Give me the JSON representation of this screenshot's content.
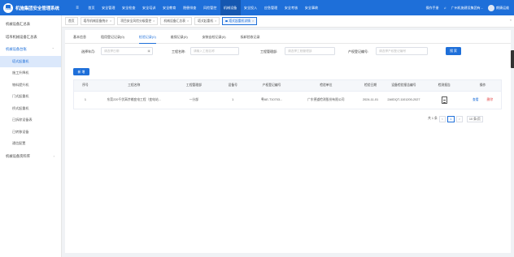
{
  "app": {
    "title": "机施集团安全管理系统",
    "logo_text": "中国建筑"
  },
  "topnav": {
    "toggle": "≡",
    "items": [
      "首页",
      "安全管理",
      "安全检查",
      "安全培训",
      "安全教育",
      "隐患排查",
      "风险管控",
      "机械设备",
      "安全投入",
      "应急管理",
      "安全考核",
      "安全事故"
    ],
    "active_index": 7,
    "manual": "操作手册",
    "company": "广州机施建设集团有...",
    "username": "朗康运维"
  },
  "sidebar": {
    "items": [
      {
        "label": "机械设备汇总表",
        "type": "item"
      },
      {
        "label": "塔吊机械设备汇总表",
        "type": "item"
      },
      {
        "label": "机械设备台账",
        "type": "parent"
      },
      {
        "label": "塔式起重机",
        "type": "sub",
        "active": true
      },
      {
        "label": "施工升降机",
        "type": "sub"
      },
      {
        "label": "物料提升机",
        "type": "sub"
      },
      {
        "label": "门式起重机",
        "type": "sub"
      },
      {
        "label": "桥式起重机",
        "type": "sub"
      },
      {
        "label": "已拆除设备表",
        "type": "sub"
      },
      {
        "label": "已转移设备",
        "type": "sub"
      },
      {
        "label": "通信配置",
        "type": "sub"
      },
      {
        "label": "机械设备资料库",
        "type": "item"
      }
    ]
  },
  "tabs": [
    {
      "label": "首页",
      "close": false
    },
    {
      "label": "塔吊机械设备统计",
      "close": true
    },
    {
      "label": "项目安全风险分级管控",
      "close": true
    },
    {
      "label": "机械设备汇总表",
      "close": true
    },
    {
      "label": "塔式起重机",
      "close": true
    },
    {
      "label": "塔式起重机详情",
      "close": true,
      "active": true
    }
  ],
  "subtabs": [
    "基本信息",
    "租用登记记录(0)",
    "检验记录(0)",
    "维保记录(0)",
    "安装自检记录(0)",
    "拆卸验收记录"
  ],
  "subtab_active": 2,
  "filters": {
    "date_label": "选择年月:",
    "date_placeholder": "请选择日期",
    "project_label": "工程名称:",
    "project_placeholder": "请输入工程名称",
    "manager_label": "工程管理部:",
    "manager_placeholder": "请选择工程管理部",
    "property_label": "产权登记编号:",
    "property_placeholder": "请选择产权登记编号",
    "search_button": "搜 索"
  },
  "add_button": "新 增",
  "table": {
    "columns": [
      "序号",
      "工程名称",
      "工程管理部",
      "设备号",
      "产权登记编号",
      "检验单位",
      "检验日期",
      "设备检验报告编号",
      "检测报告",
      "操作"
    ],
    "rows": [
      {
        "index": "1",
        "project": "东莞220千伏高埗输变电工程（变电站...",
        "manager": "一分部",
        "device_no": "1",
        "property_no": "粤AE-T10703...",
        "unit": "广东德道检测股份有限公司",
        "date": "2024-11-01",
        "report_no": "2A0DQT-1101200-2027",
        "action_view": "查看",
        "action_delete": "删除"
      }
    ]
  },
  "pager": {
    "total": "共 1 条",
    "prev": "<",
    "page": "1",
    "next": ">",
    "size": "10 条/页"
  }
}
